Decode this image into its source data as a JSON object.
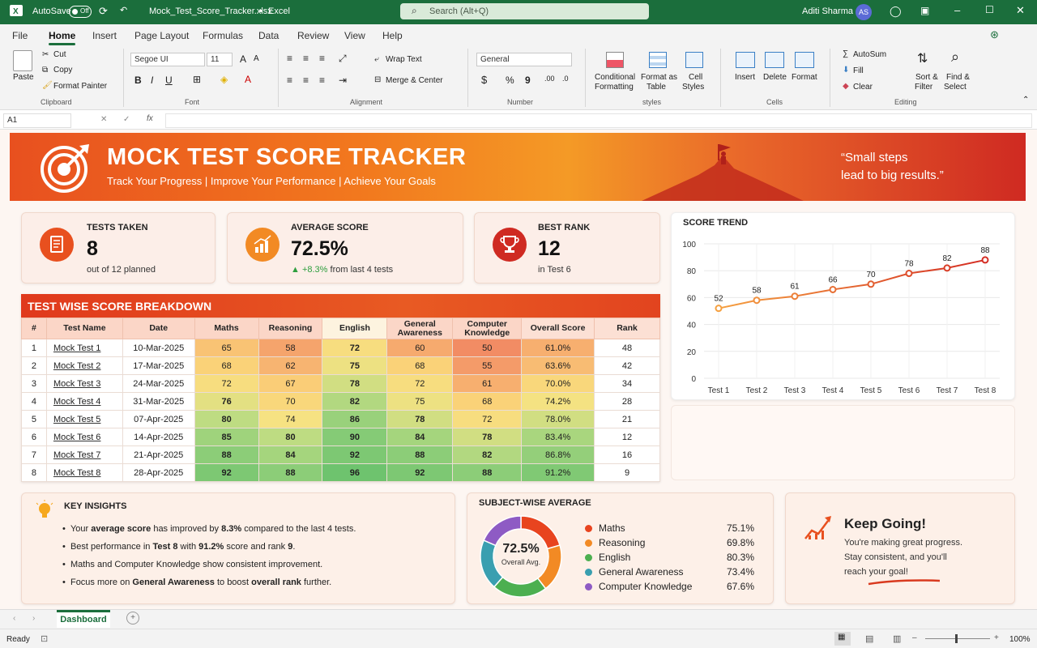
{
  "titlebar": {
    "autosave": "AutoSave",
    "toggle": "Off",
    "filename": "Mock_Test_Score_Tracker.xlsx",
    "sep": "•",
    "app": "Excel",
    "search_placeholder": "Search (Alt+Q)",
    "user": "Aditi Sharma",
    "initials": "AS"
  },
  "tabs": [
    "File",
    "Home",
    "Insert",
    "Page Layout",
    "Formulas",
    "Data",
    "Review",
    "View",
    "Help"
  ],
  "ribbon": {
    "paste": "Paste",
    "cut": "Cut",
    "copy": "Copy",
    "format_painter": "Format Painter",
    "clipboard": "Clipboard",
    "font_name": "Segoe UI",
    "font_size": "11",
    "font_group": "Font",
    "wrap_text": "Wrap Text",
    "merge_center": "Merge & Center",
    "alignment": "Alignment",
    "number_format": "General",
    "number": "Number",
    "cond_format_1": "Conditional",
    "cond_format_2": "Formatting",
    "format_table_1": "Format as",
    "format_table_2": "Table",
    "cell_styles_1": "Cell",
    "cell_styles_2": "Styles",
    "styles": "styles",
    "insert": "Insert",
    "delete": "Delete",
    "format": "Format",
    "cells": "Cells",
    "autosum": "AutoSum",
    "fill": "Fill",
    "clear": "Clear",
    "sort_1": "Sort &",
    "sort_2": "Filter",
    "find_1": "Find &",
    "find_2": "Select",
    "editing": "Editing"
  },
  "formula_bar": {
    "cell_ref": "A1",
    "fx": "fx"
  },
  "banner": {
    "title": "MOCK TEST SCORE TRACKER",
    "subtitle": "Track Your Progress  |  Improve Your Performance  |  Achieve Your Goals",
    "quote_1": "“Small steps",
    "quote_2": "lead to big results.”"
  },
  "kpis": [
    {
      "label": "TESTS TAKEN",
      "value": "8",
      "sub": "out of 12 planned"
    },
    {
      "label": "AVERAGE SCORE",
      "value": "72.5%",
      "sub_up": "▲ +8.3%",
      "sub": "from last 4 tests"
    },
    {
      "label": "BEST RANK",
      "value": "12",
      "sub": "in Test 6"
    }
  ],
  "table": {
    "title": "TEST WISE SCORE BREAKDOWN",
    "headers": [
      "#",
      "Test Name",
      "Date",
      "Maths",
      "Reasoning",
      "English",
      "General Awareness",
      "Computer Knowledge",
      "Overall Score",
      "Rank"
    ],
    "rows": [
      [
        "1",
        "Mock Test 1",
        "10-Mar-2025",
        "65",
        "58",
        "72",
        "60",
        "50",
        "61.0%",
        "48"
      ],
      [
        "2",
        "Mock Test 2",
        "17-Mar-2025",
        "68",
        "62",
        "75",
        "68",
        "55",
        "63.6%",
        "42"
      ],
      [
        "3",
        "Mock Test 3",
        "24-Mar-2025",
        "72",
        "67",
        "78",
        "72",
        "61",
        "70.0%",
        "34"
      ],
      [
        "4",
        "Mock Test 4",
        "31-Mar-2025",
        "76",
        "70",
        "82",
        "75",
        "68",
        "74.2%",
        "28"
      ],
      [
        "5",
        "Mock Test 5",
        "07-Apr-2025",
        "80",
        "74",
        "86",
        "78",
        "72",
        "78.0%",
        "21"
      ],
      [
        "6",
        "Mock Test 6",
        "14-Apr-2025",
        "85",
        "80",
        "90",
        "84",
        "78",
        "83.4%",
        "12"
      ],
      [
        "7",
        "Mock Test 7",
        "21-Apr-2025",
        "88",
        "84",
        "92",
        "88",
        "82",
        "86.8%",
        "16"
      ],
      [
        "8",
        "Mock Test 8",
        "28-Apr-2025",
        "92",
        "88",
        "96",
        "92",
        "88",
        "91.2%",
        "9"
      ]
    ]
  },
  "chart_data": [
    {
      "type": "line",
      "title": "SCORE TREND",
      "categories": [
        "Test 1",
        "Test 2",
        "Test 3",
        "Test 4",
        "Test 5",
        "Test 6",
        "Test 7",
        "Test 8"
      ],
      "values": [
        52,
        58,
        61,
        66,
        70,
        78,
        82,
        88
      ],
      "ylim": [
        0,
        100
      ],
      "yticks": [
        0,
        20,
        40,
        60,
        80,
        100
      ],
      "grid": true
    },
    {
      "type": "pie",
      "title": "SUBJECT-WISE AVERAGE",
      "center_value": "72.5%",
      "center_label": "Overall Avg.",
      "labels": [
        "Maths",
        "Reasoning",
        "English",
        "General Awareness",
        "Computer Knowledge"
      ],
      "values": [
        75.1,
        69.8,
        80.3,
        73.4,
        67.6
      ],
      "display": [
        "75.1%",
        "69.8%",
        "80.3%",
        "73.4%",
        "67.6%"
      ],
      "colors": [
        "#e8441f",
        "#f28a24",
        "#4caf50",
        "#3a9fb0",
        "#8e5bc4"
      ]
    }
  ],
  "insights": {
    "title": "KEY INSIGHTS",
    "items": [
      {
        "a": "Your ",
        "b": "average score",
        "c": " has improved by ",
        "d": "8.3%",
        "e": " compared to the last 4 tests."
      },
      {
        "a": "Best performance in ",
        "b": "Test 8",
        "c": " with ",
        "d": "91.2%",
        "e": " score and rank ",
        "f": "9",
        "g": "."
      },
      {
        "a": "Maths and Computer Knowledge show consistent improvement."
      },
      {
        "a": "Focus more on ",
        "b": "General Awareness",
        "c": " to boost ",
        "d": "overall rank",
        "e": " further."
      }
    ]
  },
  "motivation": {
    "title": "Keep Going!",
    "line1": "You're making great progress.",
    "line2": "Stay consistent, and you'll",
    "line3": "reach your goal!"
  },
  "sheet_tab": "Dashboard",
  "status": {
    "ready": "Ready",
    "zoom": "100%"
  },
  "colors": {
    "excel_green": "#1b6e3c",
    "accent_orange": "#e8501f",
    "accent_red": "#cf2a22"
  }
}
